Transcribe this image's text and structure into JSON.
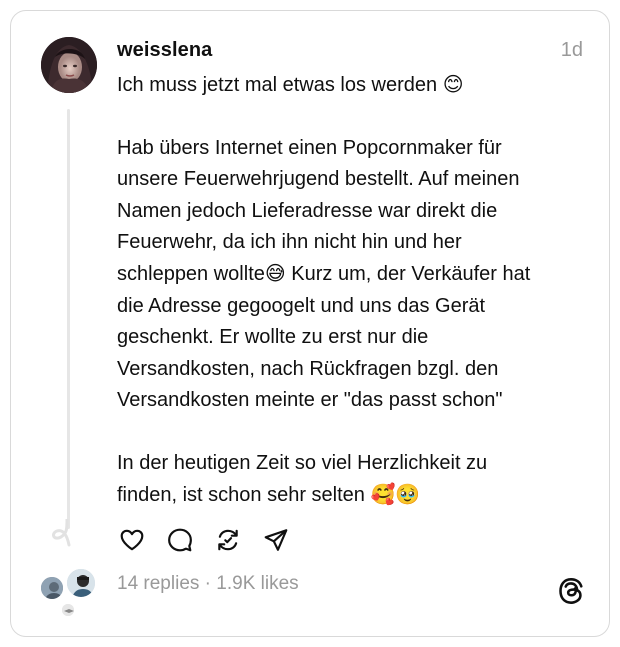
{
  "post": {
    "username": "weisslena",
    "timestamp": "1d",
    "text_line1": "Ich muss jetzt mal etwas los werden ",
    "emoji1": "😊",
    "paragraph2_part1": "Hab übers Internet einen Popcornmaker für\nunsere Feuerwehrjugend bestellt. Auf meinen\nNamen jedoch Lieferadresse war direkt die\nFeuerwehr, da ich ihn nicht hin und her\nschleppen wollte",
    "emoji2": "😅",
    "paragraph2_part2": " Kurz um, der Verkäufer hat\ndie Adresse gegoogelt und uns das Gerät\ngeschenkt. Er wollte zu erst nur die\nVersandkosten, nach Rückfragen bzgl. den\nVersandkosten meinte er \"das passt schon\"",
    "paragraph3": "In der heutigen Zeit so viel Herzlichkeit zu\nfinden, ist schon sehr selten ",
    "emoji3": "🥰🥹"
  },
  "stats": {
    "replies": "14 replies",
    "separator": " · ",
    "likes": "1.9K likes"
  },
  "icons": {
    "like": "heart-icon",
    "reply": "speech-bubble-icon",
    "repost": "repost-icon",
    "share": "send-icon",
    "brand": "threads-logo-icon"
  },
  "colors": {
    "text": "#101010",
    "secondary": "#999999",
    "border": "#d9d9d9"
  }
}
